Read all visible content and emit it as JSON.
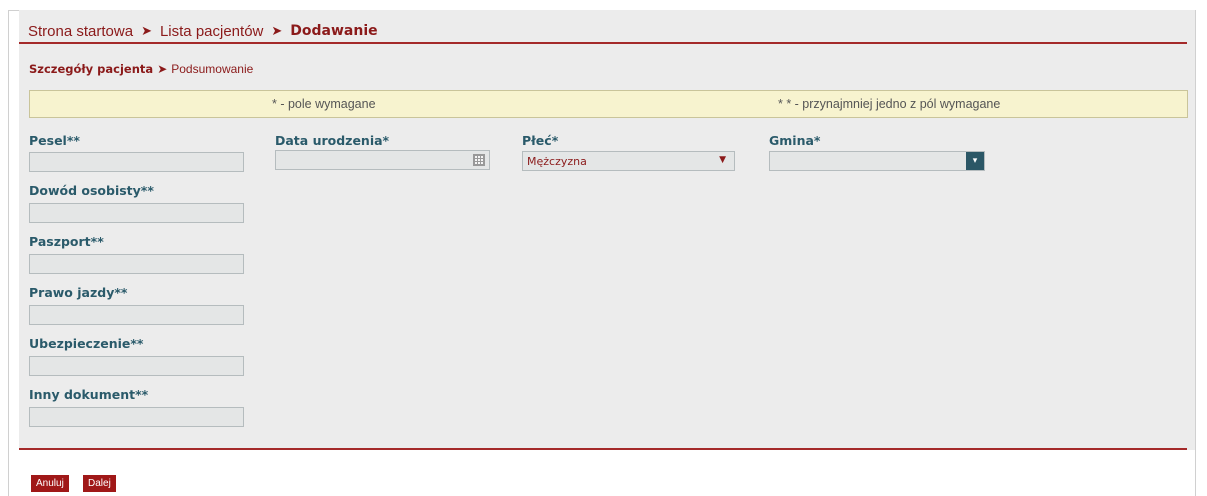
{
  "breadcrumb": {
    "items": [
      "Strona startowa",
      "Lista pacjentów"
    ],
    "current": "Dodawanie",
    "separator": "➤"
  },
  "steps": {
    "active": "Szczegóły pacjenta",
    "separator": "➤",
    "next": "Podsumowanie"
  },
  "notice": {
    "required": "* - pole wymagane",
    "one_required": "* * - przynajmniej jedno z pól wymagane"
  },
  "fields": {
    "pesel": {
      "label": "Pesel**",
      "value": ""
    },
    "dowod": {
      "label": "Dowód osobisty**",
      "value": ""
    },
    "paszport": {
      "label": "Paszport**",
      "value": ""
    },
    "prawo_jazdy": {
      "label": "Prawo jazdy**",
      "value": ""
    },
    "ubezpieczenie": {
      "label": "Ubezpieczenie**",
      "value": ""
    },
    "inny": {
      "label": "Inny dokument**",
      "value": ""
    },
    "data_urodzenia": {
      "label": "Data urodzenia*",
      "value": ""
    },
    "plec": {
      "label": "Płeć*",
      "value": "Mężczyzna"
    },
    "gmina": {
      "label": "Gmina*",
      "value": ""
    }
  },
  "buttons": {
    "cancel": "Anuluj",
    "next": "Dalej"
  },
  "colors": {
    "accent": "#a42a2a",
    "label": "#2a5a6a",
    "notice_bg": "#f7f3cf"
  },
  "icons": {
    "date_picker": "calendar-icon",
    "select": "caret-down-icon",
    "combo": "dropdown-icon"
  }
}
